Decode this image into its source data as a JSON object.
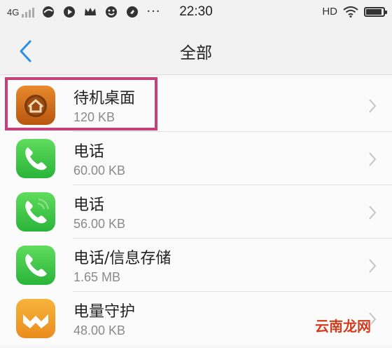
{
  "status_bar": {
    "network": "4G",
    "time": "22:30",
    "hd": "HD",
    "dots": "···",
    "battery_level": 0.85
  },
  "nav": {
    "title": "全部"
  },
  "apps": [
    {
      "name": "待机桌面",
      "size": "120 KB",
      "icon": "home-launcher-icon"
    },
    {
      "name": "电话",
      "size": "60.00 KB",
      "icon": "phone-icon"
    },
    {
      "name": "电话",
      "size": "56.00 KB",
      "icon": "phone-wave-icon"
    },
    {
      "name": "电话/信息存储",
      "size": "1.65 MB",
      "icon": "phone-storage-icon"
    },
    {
      "name": "电量守护",
      "size": "48.00 KB",
      "icon": "battery-guard-icon"
    }
  ],
  "colors": {
    "highlight": "#c8407a",
    "phone_green": "#3fca4a",
    "launcher_orange": "#d2701c",
    "battery_guard_orange": "#f0a030",
    "watermark": "#d23c1e"
  },
  "watermark": "云南龙网"
}
